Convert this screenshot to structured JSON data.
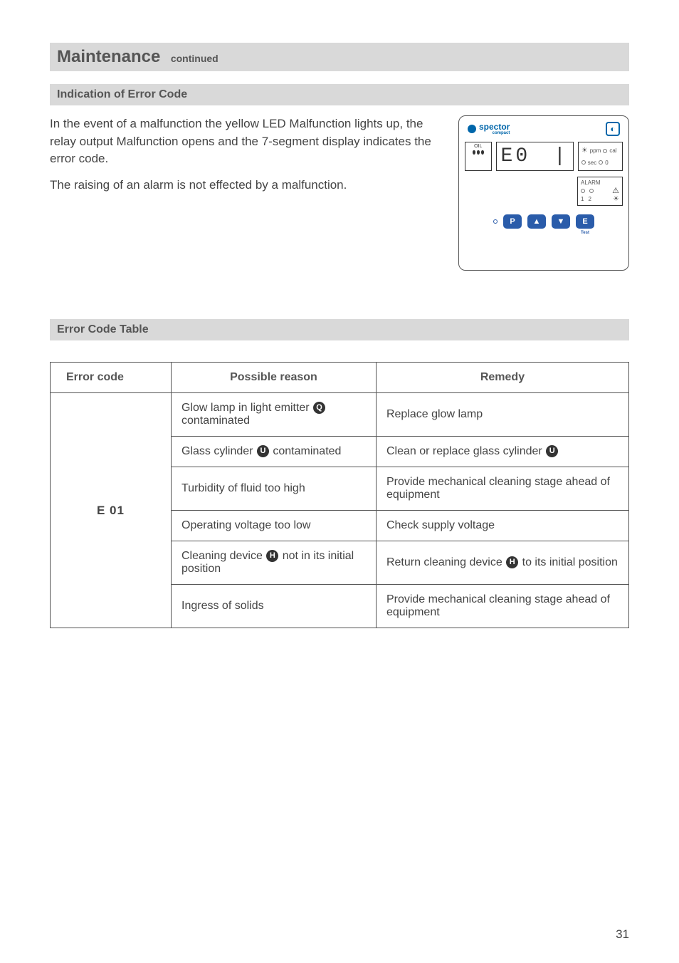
{
  "header": {
    "title": "Maintenance",
    "subtitle": "continued"
  },
  "sections": {
    "indication": {
      "heading": "Indication of Error Code",
      "p1": "In the event of a malfunction the yellow LED Malfunction lights up, the relay output Malfunction opens and the 7-segment display indicates the error code.",
      "p2": "The raising of an alarm is not effected by a malfunction."
    },
    "table_heading": "Error Code Table"
  },
  "panel": {
    "brand": "spector",
    "brand_sub": "compact",
    "oil": "OIL",
    "seg": "E0",
    "ppm": "ppm",
    "cal": "cal",
    "sec": "sec",
    "zero": "0",
    "alarm": "ALARM",
    "a1": "1",
    "a2": "2",
    "btnP": "P",
    "btnUp": "▲",
    "btnDown": "▼",
    "btnE": "E",
    "test": "Test"
  },
  "table": {
    "col_error": "Error code",
    "col_reason": "Possible reason",
    "col_remedy": "Remedy",
    "code": "E 01",
    "rows": [
      {
        "reason_pre": "Glow lamp in light emitter ",
        "reason_letter": "Q",
        "reason_post": " contaminated",
        "remedy_pre": "Replace glow lamp",
        "remedy_letter": "",
        "remedy_post": ""
      },
      {
        "reason_pre": "Glass cylinder ",
        "reason_letter": "U",
        "reason_post": " contaminated",
        "remedy_pre": "Clean or replace glass cylinder ",
        "remedy_letter": "U",
        "remedy_post": ""
      },
      {
        "reason_pre": "Turbidity of fluid too high",
        "reason_letter": "",
        "reason_post": "",
        "remedy_pre": "Provide mechanical cleaning stage ahead of equipment",
        "remedy_letter": "",
        "remedy_post": ""
      },
      {
        "reason_pre": "Operating voltage too low",
        "reason_letter": "",
        "reason_post": "",
        "remedy_pre": "Check supply voltage",
        "remedy_letter": "",
        "remedy_post": ""
      },
      {
        "reason_pre": "Cleaning device ",
        "reason_letter": "H",
        "reason_post": " not in its  initial position",
        "remedy_pre": "Return cleaning device ",
        "remedy_letter": "H",
        "remedy_post": " to its initial position"
      },
      {
        "reason_pre": "Ingress of solids",
        "reason_letter": "",
        "reason_post": "",
        "remedy_pre": "Provide mechanical cleaning stage ahead of equipment",
        "remedy_letter": "",
        "remedy_post": ""
      }
    ]
  },
  "page_number": "31"
}
